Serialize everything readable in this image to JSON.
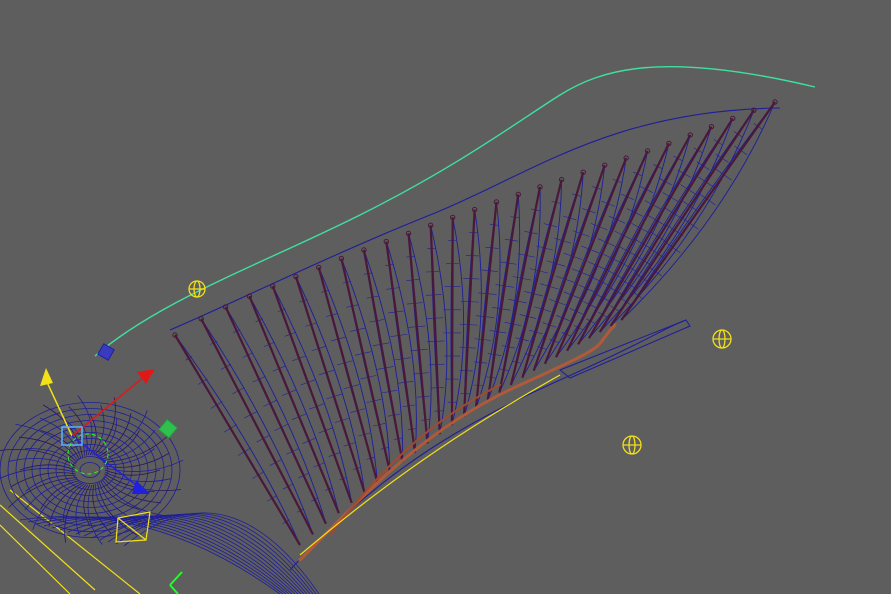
{
  "viewport": {
    "background": "#5e5e5e"
  },
  "colors": {
    "wireframe": "#1e1e9a",
    "wireframe_dark": "#2a145a",
    "feather_shaft": "#4a1838",
    "bone": "#b05a3a",
    "motion_curve": "#3fe0a0",
    "locator": "#f2e018",
    "manip_y": "#f2e018",
    "manip_x": "#e01818",
    "manip_z": "#2020e0",
    "manip_green": "#30c050",
    "selection_box": "#5ab4ff",
    "bright_green": "#22ff22"
  },
  "icons": [
    "translate-manipulator-icon",
    "locator-icon",
    "motion-path-icon",
    "control-handle-icon"
  ]
}
